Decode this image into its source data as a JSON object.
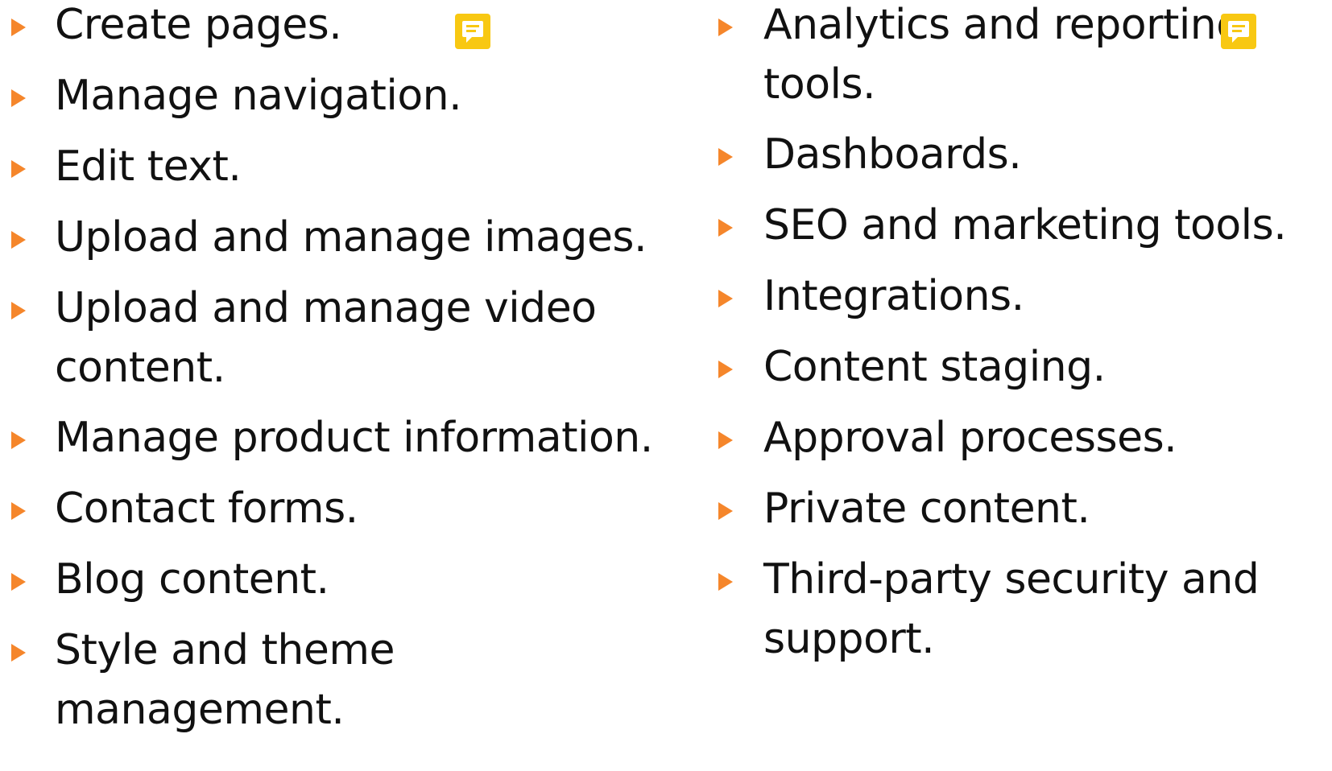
{
  "left_column": {
    "items": [
      {
        "lines": [
          "Create pages."
        ]
      },
      {
        "lines": [
          "Manage navigation."
        ]
      },
      {
        "lines": [
          "Edit text."
        ]
      },
      {
        "lines": [
          "Upload and manage images."
        ]
      },
      {
        "lines": [
          "Upload and manage video",
          "content."
        ]
      },
      {
        "lines": [
          "Manage product information."
        ]
      },
      {
        "lines": [
          "Contact forms."
        ]
      },
      {
        "lines": [
          "Blog content."
        ]
      },
      {
        "lines": [
          "Style and theme",
          "management."
        ]
      }
    ]
  },
  "right_column": {
    "items": [
      {
        "lines": [
          "Analytics and reporting",
          "tools."
        ]
      },
      {
        "lines": [
          "Dashboards."
        ]
      },
      {
        "lines": [
          "SEO and marketing tools."
        ]
      },
      {
        "lines": [
          "Integrations."
        ]
      },
      {
        "lines": [
          "Content staging."
        ]
      },
      {
        "lines": [
          "Approval processes."
        ]
      },
      {
        "lines": [
          "Private content."
        ]
      },
      {
        "lines": [
          "Third-party security and",
          "support."
        ]
      }
    ]
  },
  "colors": {
    "bullet": "#f5862b",
    "comment_icon": "#f8c812",
    "text": "#111111"
  },
  "icons": {
    "bullet": "orange-triangle-bullet-icon",
    "comment": "comment-icon"
  }
}
